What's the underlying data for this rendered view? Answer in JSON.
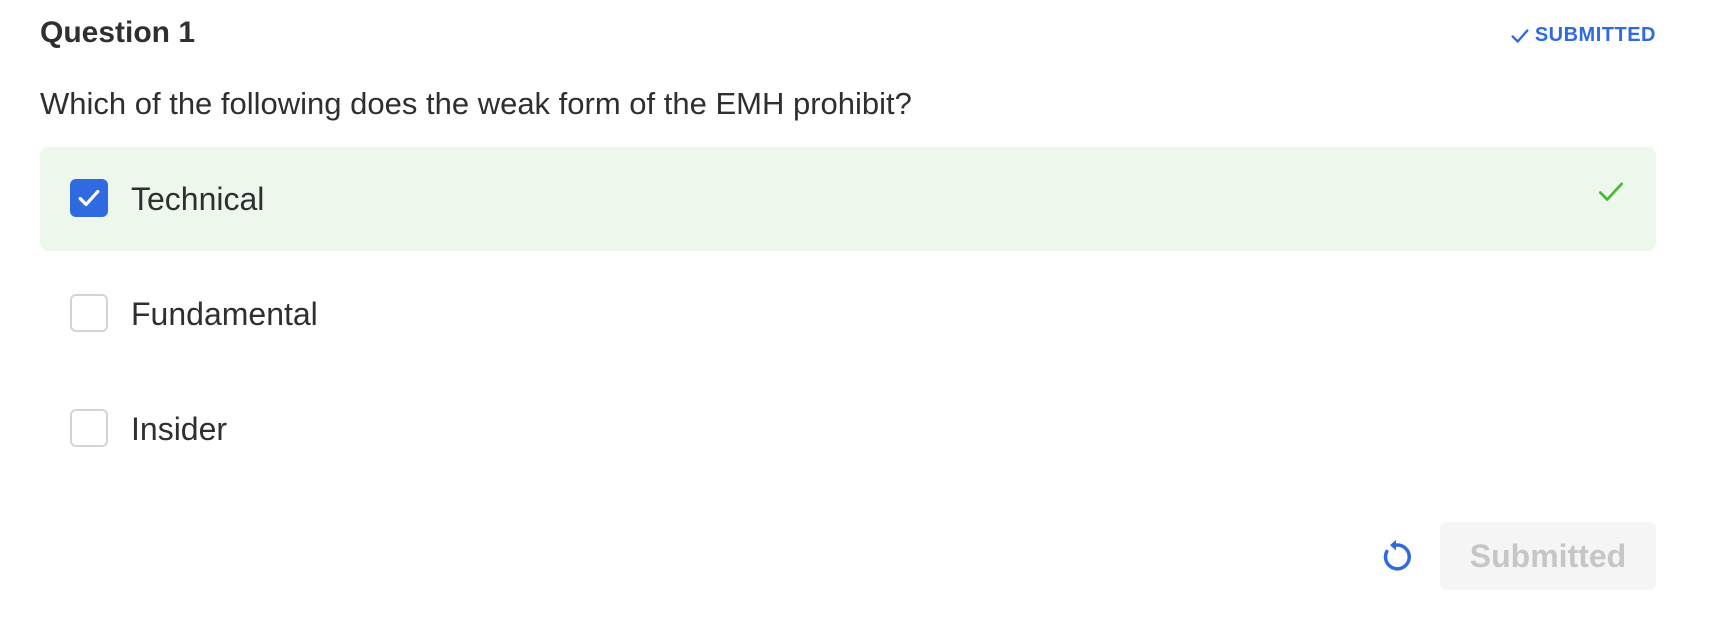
{
  "question": {
    "title": "Question 1",
    "status_label": "SUBMITTED",
    "status_icon": "check-icon",
    "text": "Which of the following does the weak form of the EMH prohibit?"
  },
  "options": [
    {
      "label": "Technical",
      "checked": true,
      "result": "correct",
      "result_icon": "check-icon"
    },
    {
      "label": "Fundamental",
      "checked": false
    },
    {
      "label": "Insider",
      "checked": false
    }
  ],
  "footer": {
    "reset_icon": "reset-icon",
    "submit_label": "Submitted",
    "submit_disabled": true
  },
  "colors": {
    "accent": "#2f6ae0",
    "correct_bg": "#edf7eb",
    "correct_icon": "#4cb83a",
    "text": "#2d2f31",
    "disabled_bg": "#f5f5f5",
    "disabled_text": "#c4c6c8"
  }
}
